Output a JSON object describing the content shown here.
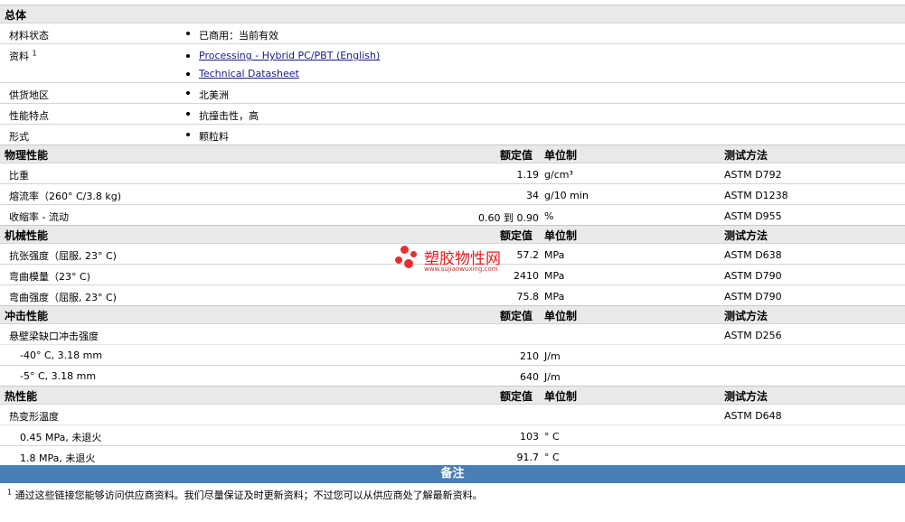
{
  "general": {
    "title": "总体",
    "rows": [
      {
        "label": "材料状态",
        "values": [
          "已商用：当前有效"
        ]
      },
      {
        "label": "资料",
        "sup": "1",
        "links": [
          "Processing - Hybrid PC/PBT (English)",
          "Technical Datasheet"
        ]
      },
      {
        "label": "供货地区",
        "values": [
          "北美洲"
        ]
      },
      {
        "label": "性能特点",
        "values": [
          "抗撞击性，高"
        ]
      },
      {
        "label": "形式",
        "values": [
          "颗粒料"
        ]
      }
    ]
  },
  "headers": {
    "value": "额定值",
    "unit": "单位制",
    "method": "测试方法"
  },
  "physical": {
    "title": "物理性能",
    "rows": [
      {
        "label": "比重",
        "value": "1.19",
        "unit": "g/cm³",
        "method": "ASTM D792"
      },
      {
        "label": "熔流率（260° C/3.8 kg)",
        "value": "34",
        "unit": "g/10 min",
        "method": "ASTM D1238"
      },
      {
        "label": "收缩率 - 流动",
        "value": "0.60 到  0.90",
        "unit": "%",
        "method": "ASTM D955"
      }
    ]
  },
  "mechanical": {
    "title": "机械性能",
    "rows": [
      {
        "label": "抗张强度（屈服, 23° C)",
        "value": "57.2",
        "unit": "MPa",
        "method": "ASTM D638"
      },
      {
        "label": "弯曲模量（23° C)",
        "value": "2410",
        "unit": "MPa",
        "method": "ASTM D790"
      },
      {
        "label": "弯曲强度（屈服, 23° C)",
        "value": "75.8",
        "unit": "MPa",
        "method": "ASTM D790"
      }
    ]
  },
  "impact": {
    "title": "冲击性能",
    "rows": [
      {
        "label": "悬壁梁缺口冲击强度",
        "value": "",
        "unit": "",
        "method": "ASTM D256"
      },
      {
        "label": "-40° C, 3.18 mm",
        "value": "210",
        "unit": "J/m",
        "method": ""
      },
      {
        "label": "-5° C, 3.18 mm",
        "value": "640",
        "unit": "J/m",
        "method": ""
      }
    ]
  },
  "thermal": {
    "title": "热性能",
    "rows": [
      {
        "label": "热变形温度",
        "value": "",
        "unit": "",
        "method": "ASTM D648"
      },
      {
        "label": "0.45 MPa, 未退火",
        "value": "103",
        "unit": "° C",
        "method": ""
      },
      {
        "label": "1.8 MPa, 未退火",
        "value": "91.7",
        "unit": "° C",
        "method": ""
      }
    ]
  },
  "notes": {
    "title": "备注",
    "sup": "1",
    "text": "通过这些链接您能够访问供应商资料。我们尽量保证及时更新资料；不过您可以从供应商处了解最新资料。"
  },
  "watermark": {
    "name": "塑胶物性网",
    "url": "www.sujiaowuxing.com"
  }
}
